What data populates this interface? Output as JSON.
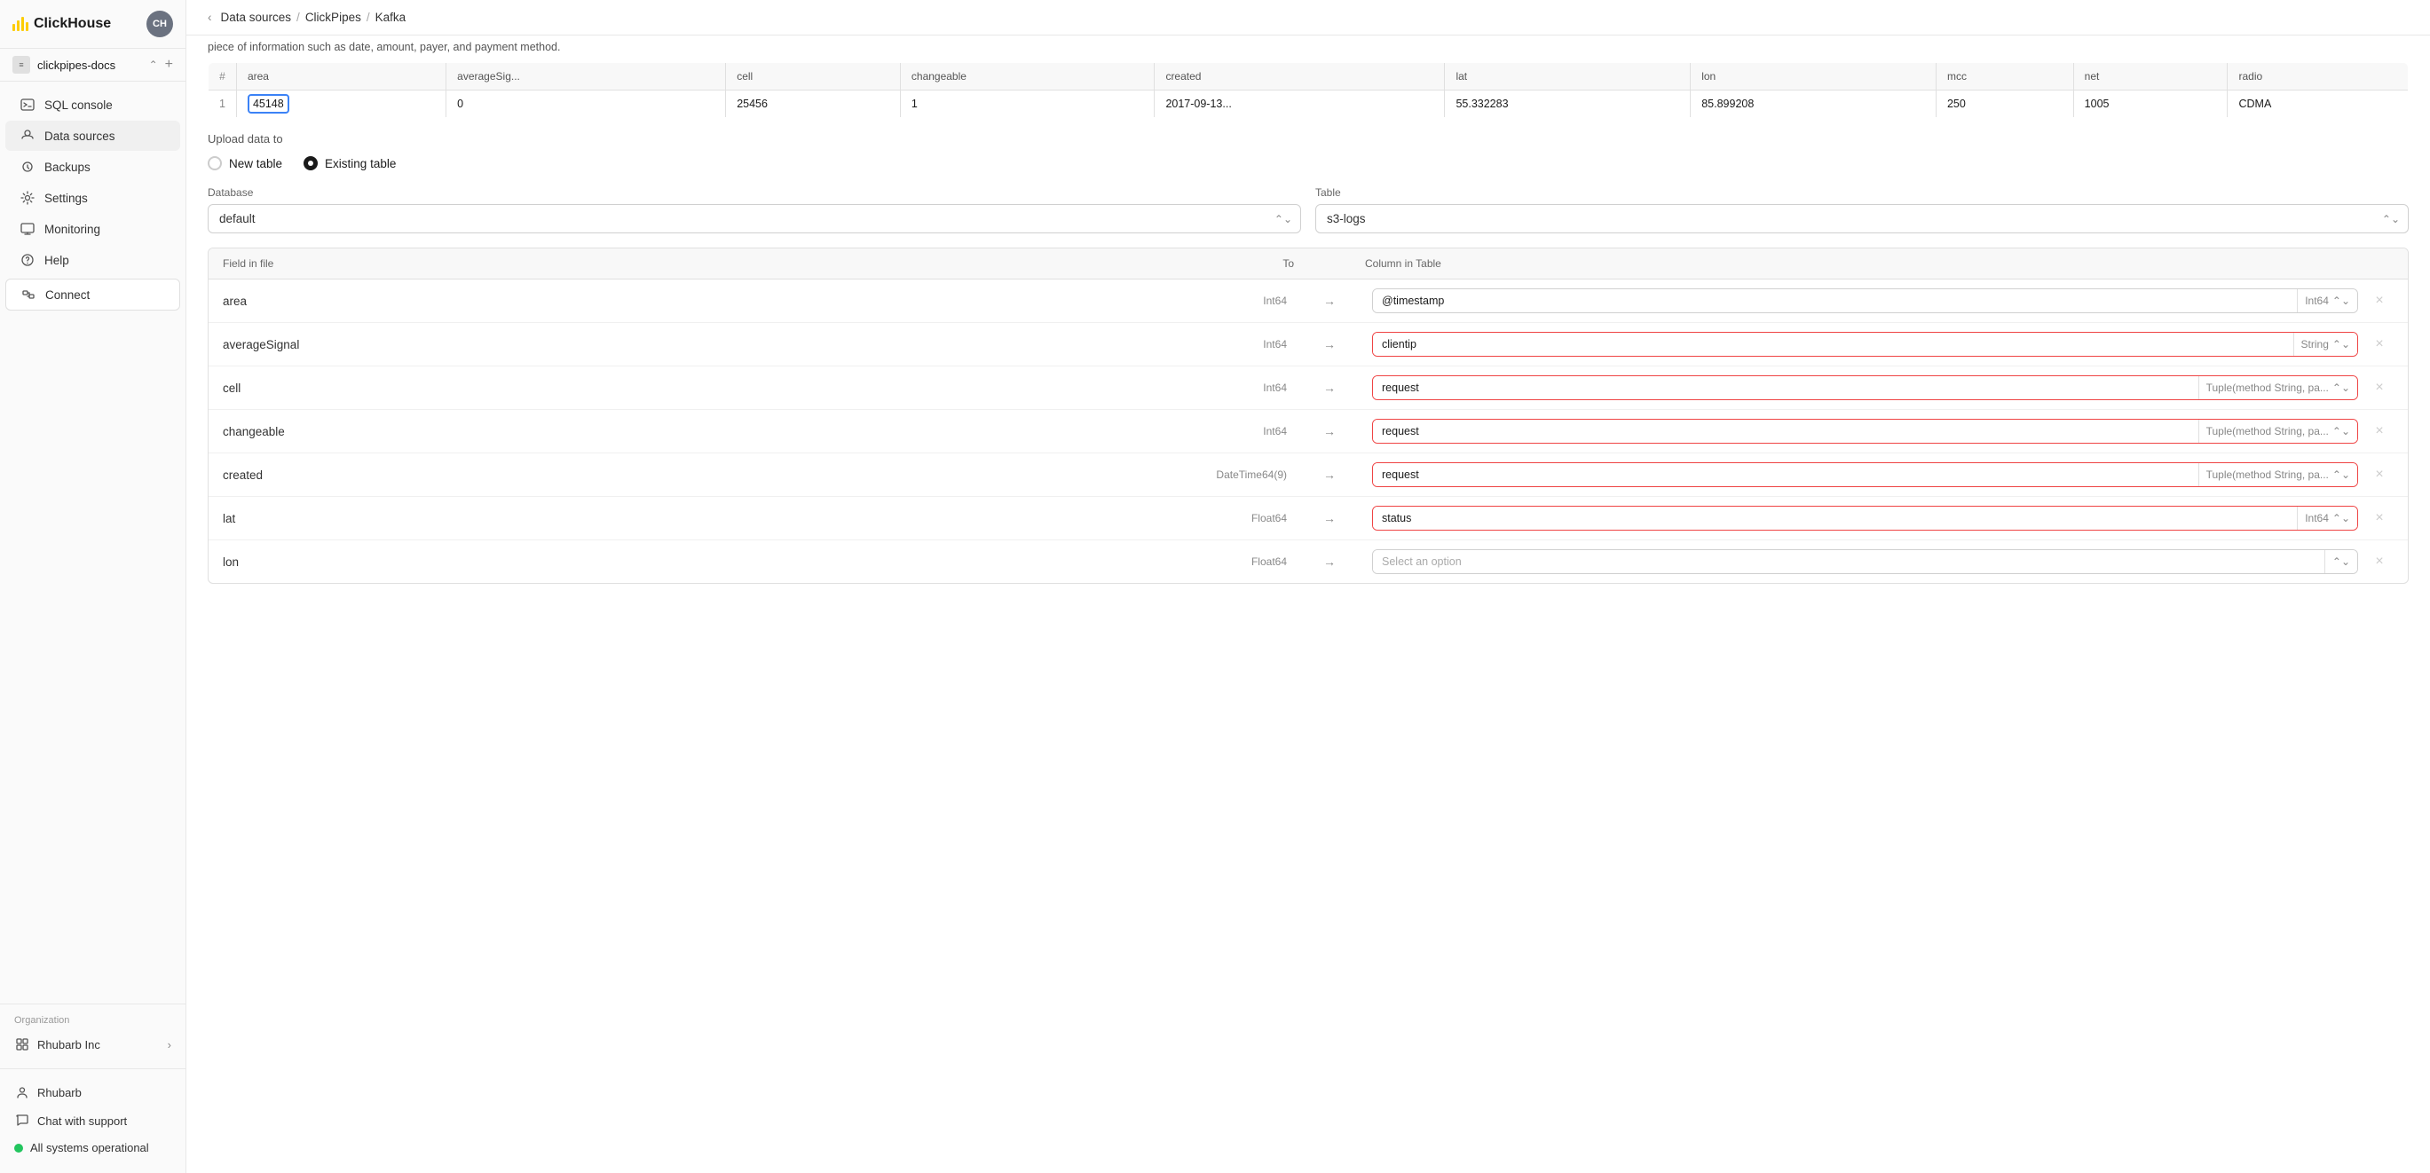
{
  "app": {
    "title": "ClickHouse",
    "avatar": "CH"
  },
  "workspace": {
    "name": "clickpipes-docs",
    "icon": "≡"
  },
  "breadcrumb": {
    "back": "‹",
    "items": [
      "Data sources",
      "ClickPipes",
      "Kafka"
    ]
  },
  "nav": {
    "items": [
      {
        "id": "sql-console",
        "label": "SQL console",
        "icon": "console"
      },
      {
        "id": "data-sources",
        "label": "Data sources",
        "icon": "datasource",
        "active": true
      },
      {
        "id": "backups",
        "label": "Backups",
        "icon": "backup"
      },
      {
        "id": "settings",
        "label": "Settings",
        "icon": "settings"
      },
      {
        "id": "monitoring",
        "label": "Monitoring",
        "icon": "monitor"
      },
      {
        "id": "help",
        "label": "Help",
        "icon": "help"
      }
    ],
    "connect": "Connect"
  },
  "org": {
    "section_label": "Organization",
    "name": "Rhubarb Inc"
  },
  "bottom": {
    "user": "Rhubarb",
    "chat": "Chat with support",
    "status": "All systems operational"
  },
  "preview": {
    "note": "piece of information such as date, amount, payer, and payment method.",
    "columns": [
      "#",
      "area",
      "averageSig...",
      "cell",
      "changeable",
      "created",
      "lat",
      "lon",
      "mcc",
      "net",
      "radio"
    ],
    "rows": [
      [
        "1",
        "45148",
        "0",
        "25456",
        "1",
        "2017-09-13...",
        "55.332283",
        "85.899208",
        "250",
        "1005",
        "CDMA"
      ]
    ]
  },
  "upload": {
    "label": "Upload data to",
    "options": [
      {
        "id": "new-table",
        "label": "New table",
        "checked": false
      },
      {
        "id": "existing-table",
        "label": "Existing table",
        "checked": true
      }
    ]
  },
  "database": {
    "label": "Database",
    "value": "default",
    "options": [
      "default"
    ]
  },
  "table_select": {
    "label": "Table",
    "value": "s3-logs",
    "options": [
      "s3-logs"
    ]
  },
  "mapping": {
    "headers": [
      "Field in file",
      "To",
      "",
      "Column in Table",
      ""
    ],
    "rows": [
      {
        "field": "area",
        "field_type": "Int64",
        "col_value": "@timestamp",
        "col_type": "Int64",
        "error": false
      },
      {
        "field": "averageSignal",
        "field_type": "Int64",
        "col_value": "clientip",
        "col_type": "String",
        "error": true
      },
      {
        "field": "cell",
        "field_type": "Int64",
        "col_value": "request",
        "col_type": "Tuple(method String, pa...",
        "error": true
      },
      {
        "field": "changeable",
        "field_type": "Int64",
        "col_value": "request",
        "col_type": "Tuple(method String, pa...",
        "error": true
      },
      {
        "field": "created",
        "field_type": "DateTime64(9)",
        "col_value": "request",
        "col_type": "Tuple(method String, pa...",
        "error": true
      },
      {
        "field": "lat",
        "field_type": "Float64",
        "col_value": "status",
        "col_type": "Int64",
        "error": true
      },
      {
        "field": "lon",
        "field_type": "Float64",
        "col_value": "Select an option",
        "col_type": "",
        "error": false,
        "placeholder": true
      }
    ]
  }
}
